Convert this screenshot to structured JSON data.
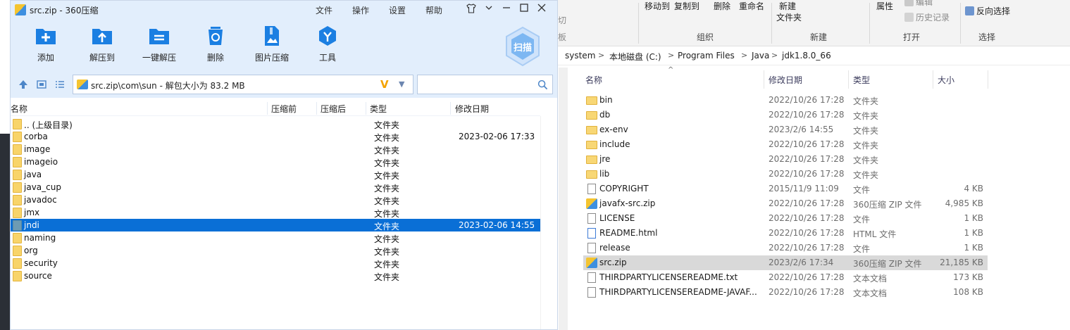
{
  "explorer": {
    "ribbon": {
      "cut_partial": "切",
      "copy_partial": "板",
      "move_to": "移动到",
      "copy_to": "复制到",
      "delete": "删除",
      "rename": "重命名",
      "new_item": "新建",
      "new_folder": "文件夹",
      "properties": "属性",
      "edit_partial": "编辑",
      "history": "历史记录",
      "invert_selection": "反向选择",
      "groups": {
        "organize": "组织",
        "new": "新建",
        "open": "打开",
        "select": "选择"
      }
    },
    "breadcrumbs": [
      "system",
      "本地磁盘 (C:)",
      "Program Files",
      "Java",
      "jdk1.8.0_66"
    ],
    "columns": {
      "name": "名称",
      "modified": "修改日期",
      "type": "类型",
      "size": "大小"
    },
    "files": [
      {
        "name": "bin",
        "date": "2022/10/26 17:28",
        "type": "文件夹",
        "size": "",
        "icon": "folder-icon"
      },
      {
        "name": "db",
        "date": "2022/10/26 17:28",
        "type": "文件夹",
        "size": "",
        "icon": "folder-icon"
      },
      {
        "name": "ex-env",
        "date": "2023/2/6 14:55",
        "type": "文件夹",
        "size": "",
        "icon": "folder-icon"
      },
      {
        "name": "include",
        "date": "2022/10/26 17:28",
        "type": "文件夹",
        "size": "",
        "icon": "folder-icon"
      },
      {
        "name": "jre",
        "date": "2022/10/26 17:28",
        "type": "文件夹",
        "size": "",
        "icon": "folder-icon"
      },
      {
        "name": "lib",
        "date": "2022/10/26 17:28",
        "type": "文件夹",
        "size": "",
        "icon": "folder-icon"
      },
      {
        "name": "COPYRIGHT",
        "date": "2015/11/9 11:09",
        "type": "文件",
        "size": "4 KB",
        "icon": "document-icon"
      },
      {
        "name": "javafx-src.zip",
        "date": "2022/10/26 17:28",
        "type": "360压缩 ZIP 文件",
        "size": "4,985 KB",
        "icon": "zip-icon"
      },
      {
        "name": "LICENSE",
        "date": "2022/10/26 17:28",
        "type": "文件",
        "size": "1 KB",
        "icon": "document-icon"
      },
      {
        "name": "README.html",
        "date": "2022/10/26 17:28",
        "type": "HTML 文件",
        "size": "1 KB",
        "icon": "html-icon"
      },
      {
        "name": "release",
        "date": "2022/10/26 17:28",
        "type": "文件",
        "size": "1 KB",
        "icon": "document-icon"
      },
      {
        "name": "src.zip",
        "date": "2023/2/6 17:34",
        "type": "360压缩 ZIP 文件",
        "size": "21,185 KB",
        "icon": "zip-icon",
        "selected": true
      },
      {
        "name": "THIRDPARTYLICENSEREADME.txt",
        "date": "2022/10/26 17:28",
        "type": "文本文档",
        "size": "173 KB",
        "icon": "document-icon"
      },
      {
        "name": "THIRDPARTYLICENSEREADME-JAVAF...",
        "date": "2022/10/26 17:28",
        "type": "文本文档",
        "size": "108 KB",
        "icon": "document-icon"
      }
    ]
  },
  "zipwin": {
    "title": "src.zip - 360压缩",
    "menu": {
      "file": "文件",
      "ops": "操作",
      "settings": "设置",
      "help": "帮助"
    },
    "toolbar": {
      "add": "添加",
      "extract_to": "解压到",
      "one_click_extract": "一键解压",
      "delete": "删除",
      "image_compress": "图片压缩",
      "tools": "工具",
      "scan": "扫描"
    },
    "path": "src.zip\\com\\sun - 解包大小为 83.2 MB",
    "search_placeholder": "",
    "columns": {
      "name": "名称",
      "compressed": "压缩前",
      "after": "压缩后",
      "type": "类型",
      "modified": "修改日期"
    },
    "rows": [
      {
        "name": ".. (上级目录)",
        "type": "文件夹",
        "date": ""
      },
      {
        "name": "corba",
        "type": "文件夹",
        "date": "2023-02-06 17:33"
      },
      {
        "name": "image",
        "type": "文件夹",
        "date": ""
      },
      {
        "name": "imageio",
        "type": "文件夹",
        "date": ""
      },
      {
        "name": "java",
        "type": "文件夹",
        "date": ""
      },
      {
        "name": "java_cup",
        "type": "文件夹",
        "date": ""
      },
      {
        "name": "javadoc",
        "type": "文件夹",
        "date": ""
      },
      {
        "name": "jmx",
        "type": "文件夹",
        "date": ""
      },
      {
        "name": "jndi",
        "type": "文件夹",
        "date": "2023-02-06 14:55",
        "selected": true
      },
      {
        "name": "naming",
        "type": "文件夹",
        "date": ""
      },
      {
        "name": "org",
        "type": "文件夹",
        "date": ""
      },
      {
        "name": "security",
        "type": "文件夹",
        "date": ""
      },
      {
        "name": "source",
        "type": "文件夹",
        "date": ""
      }
    ],
    "colors": {
      "accent": "#0a6fd6",
      "chrome": "#e2eefc",
      "folder": "#f8d46a"
    }
  }
}
